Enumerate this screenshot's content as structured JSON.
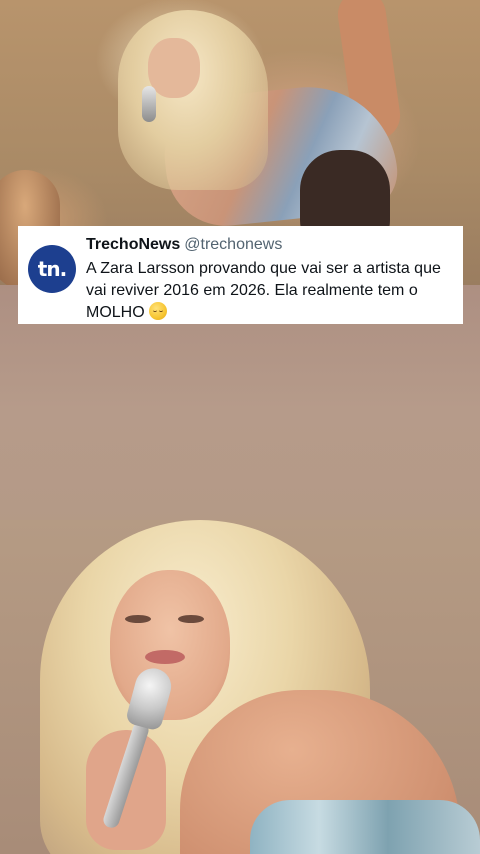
{
  "post": {
    "avatar_text": "tn.",
    "author_name": "TrechoNews",
    "author_handle": "@trechonews",
    "text": "A Zara Larsson provando que vai ser a artista que vai reviver 2016 em 2026. Ela realmente tem o MOLHO",
    "emoji_icon": "relieved-face-emoji",
    "avatar_color": "#1d3f8f"
  }
}
